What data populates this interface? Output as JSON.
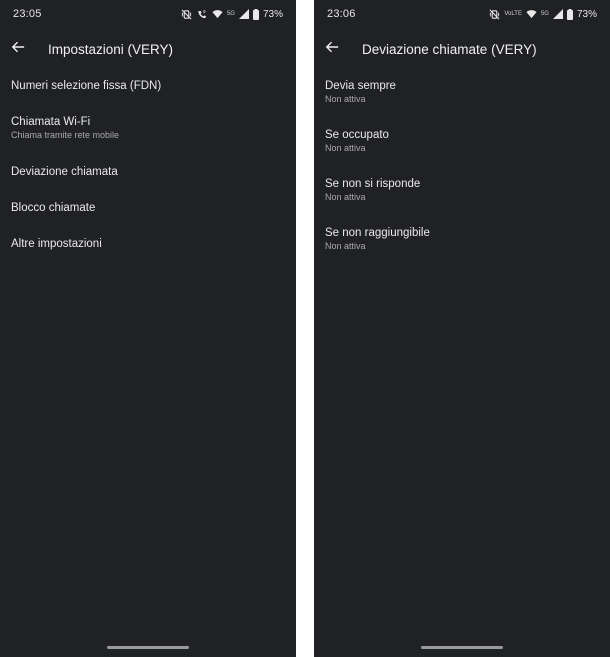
{
  "left": {
    "status": {
      "time": "23:05",
      "signal_label": "5G",
      "battery_text": "73%"
    },
    "app_bar": {
      "title": "Impostazioni (VERY)"
    },
    "items": [
      {
        "title": "Numeri selezione fissa (FDN)",
        "subtitle": ""
      },
      {
        "title": "Chiamata Wi-Fi",
        "subtitle": "Chiama tramite rete mobile"
      },
      {
        "title": "Deviazione chiamata",
        "subtitle": ""
      },
      {
        "title": "Blocco chiamate",
        "subtitle": ""
      },
      {
        "title": "Altre impostazioni",
        "subtitle": ""
      }
    ]
  },
  "right": {
    "status": {
      "time": "23:06",
      "volte_label": "VoLTE",
      "signal_label": "5G",
      "battery_text": "73%"
    },
    "app_bar": {
      "title": "Deviazione chiamate (VERY)"
    },
    "items": [
      {
        "title": "Devia sempre",
        "subtitle": "Non attiva"
      },
      {
        "title": "Se occupato",
        "subtitle": "Non attiva"
      },
      {
        "title": "Se non si risponde",
        "subtitle": "Non attiva"
      },
      {
        "title": "Se non raggiungibile",
        "subtitle": "Non attiva"
      }
    ]
  },
  "icons": {
    "back": "arrow-back-icon",
    "vibrate_off": "vibrate-off-icon",
    "wifi_call": "wifi-calling-icon",
    "wifi": "wifi-icon",
    "cell": "cell-signal-icon",
    "battery": "battery-icon"
  },
  "colors": {
    "background": "#202124",
    "text_primary": "#eaeaea",
    "text_secondary": "#a9a9a9",
    "home_indicator": "#9a9a9a"
  }
}
